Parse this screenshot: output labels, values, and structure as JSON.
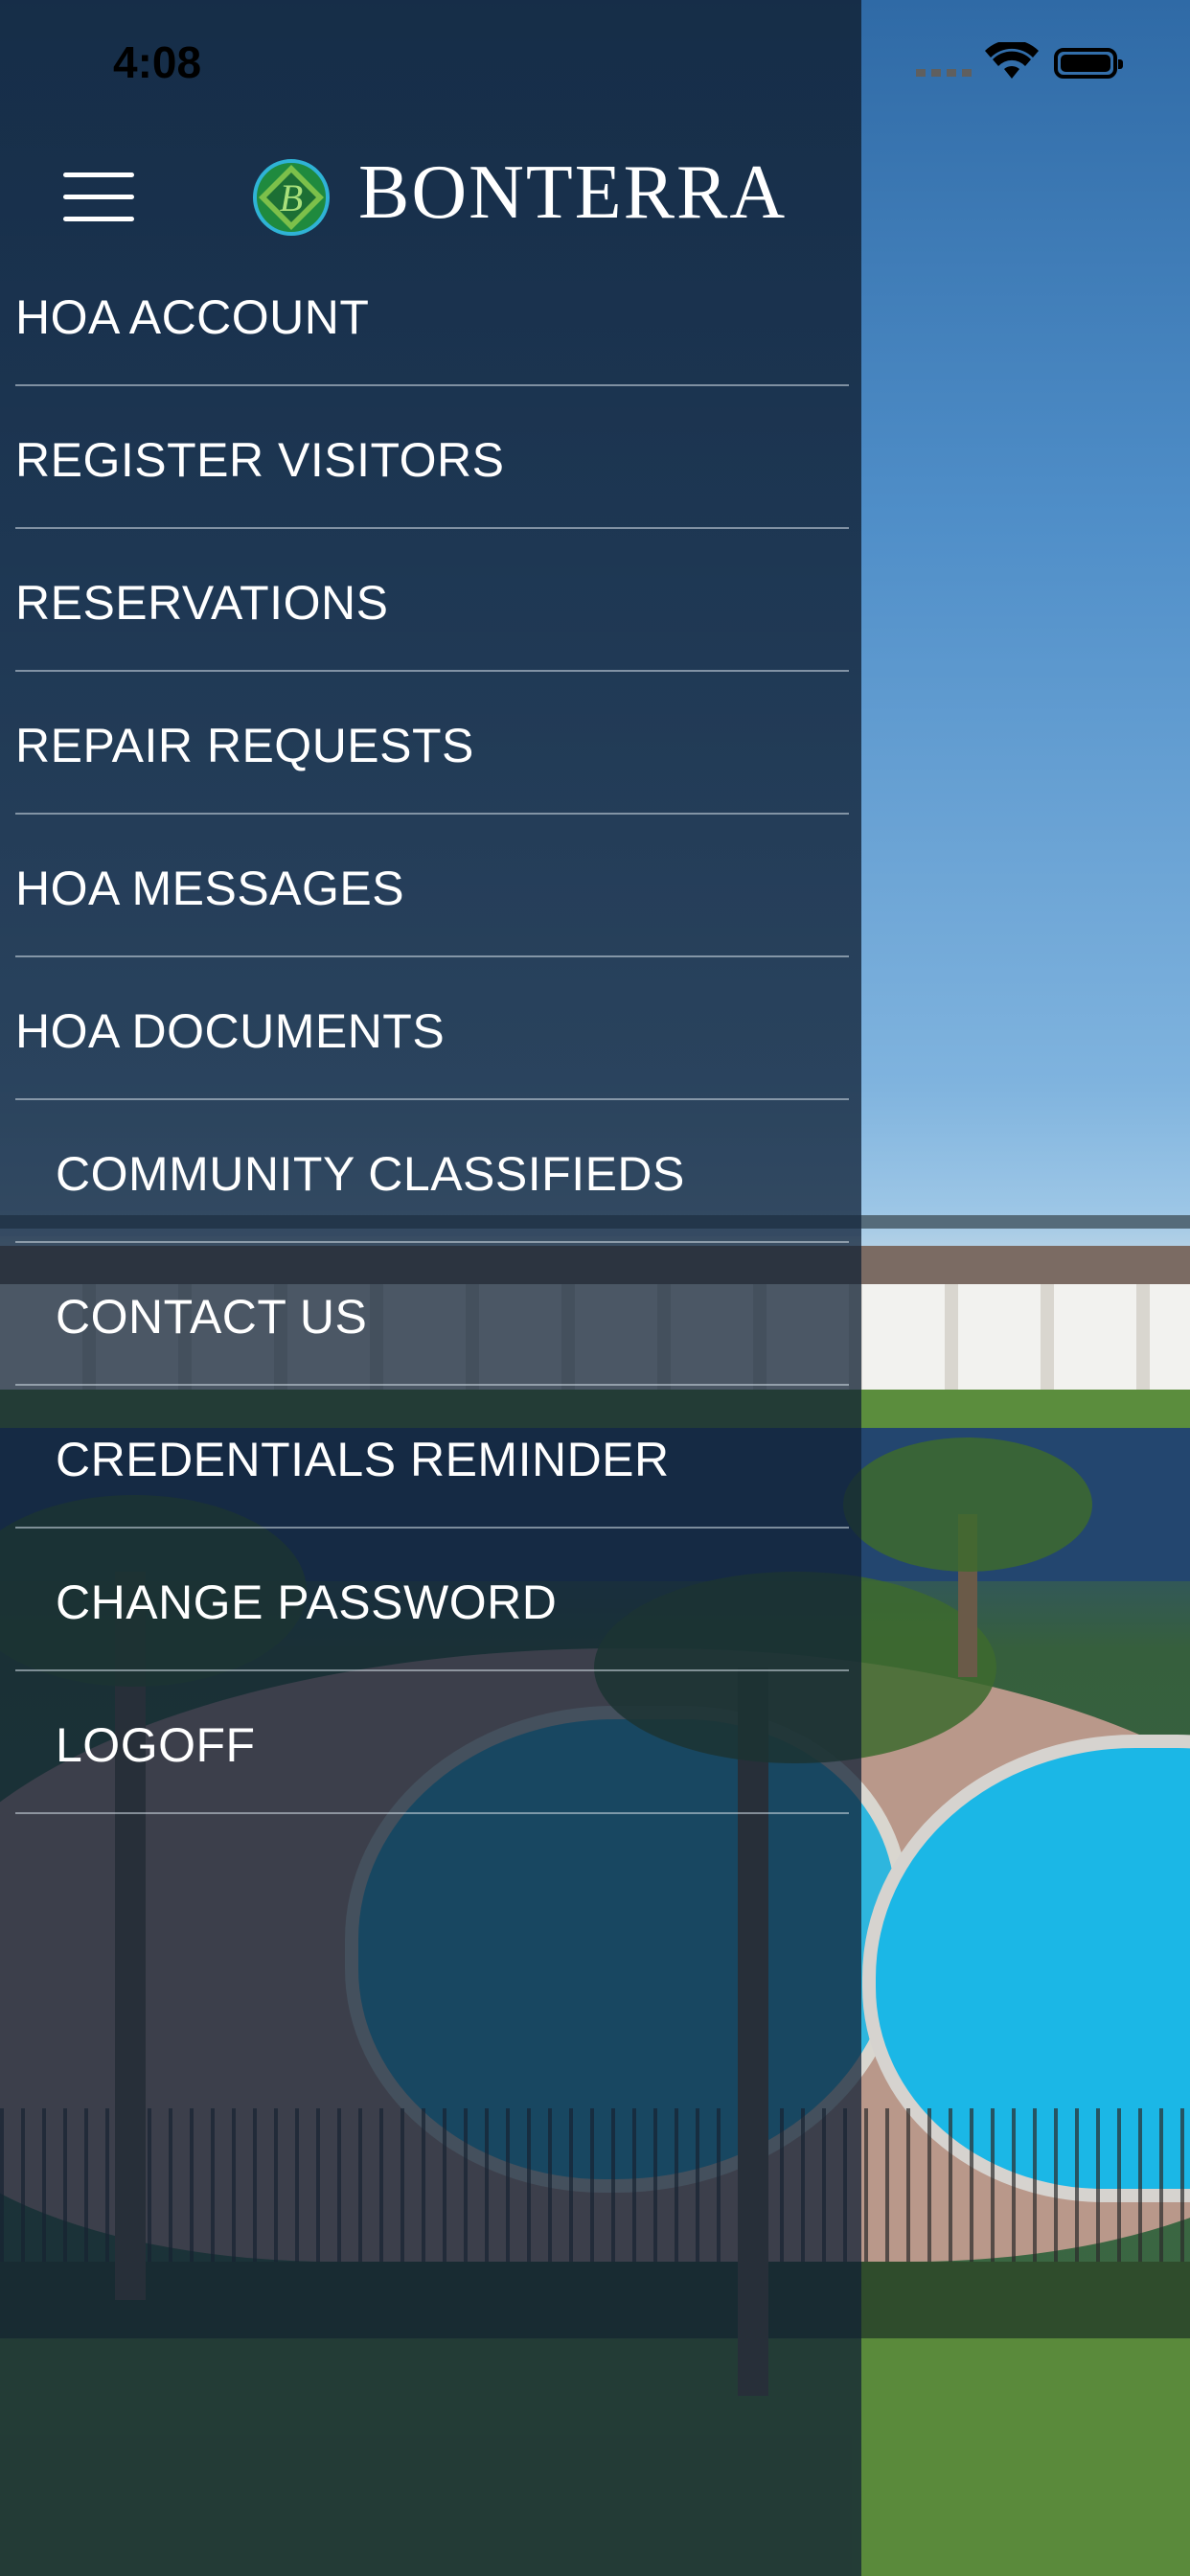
{
  "status_bar": {
    "time": "4:08",
    "icons": [
      "signal-icon",
      "wifi-icon",
      "battery-icon"
    ]
  },
  "header": {
    "menu_icon": "hamburger-icon",
    "logo_icon": "bonterra-emblem-icon",
    "logo_text": "BONTERRA"
  },
  "menu": {
    "items": [
      {
        "label": "HOA ACCOUNT"
      },
      {
        "label": "REGISTER VISITORS"
      },
      {
        "label": "RESERVATIONS"
      },
      {
        "label": "REPAIR REQUESTS"
      },
      {
        "label": "HOA MESSAGES"
      },
      {
        "label": "HOA DOCUMENTS"
      },
      {
        "label": "COMMUNITY CLASSIFIEDS"
      },
      {
        "label": "CONTACT US"
      },
      {
        "label": "CREDENTIALS REMINDER"
      },
      {
        "label": "CHANGE PASSWORD"
      },
      {
        "label": "LOGOFF"
      }
    ]
  },
  "colors": {
    "drawer_overlay": "#102034",
    "text": "#ffffff",
    "logo_green": "#2f9a44"
  }
}
